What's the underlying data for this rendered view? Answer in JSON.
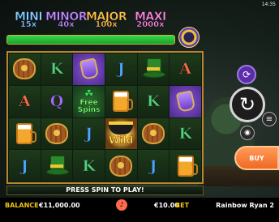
{
  "clock": "14:35",
  "jackpots": [
    {
      "name": "MINI",
      "multiplier": "15x"
    },
    {
      "name": "MINOR",
      "multiplier": "40x"
    },
    {
      "name": "MAJOR",
      "multiplier": "100x"
    },
    {
      "name": "MAXI",
      "multiplier": "2000x"
    }
  ],
  "meter": {
    "fill_percent": 100
  },
  "grid": [
    [
      "barrel",
      "K",
      "flask",
      "J",
      "hat",
      "A"
    ],
    [
      "A",
      "Q",
      "freespins",
      "beer",
      "K",
      "flask"
    ],
    [
      "beer",
      "barrel",
      "J",
      "wild",
      "barrel",
      "K"
    ],
    [
      "J",
      "hat",
      "K",
      "barrel",
      "J",
      "beer"
    ]
  ],
  "symbols": {
    "freespins_line1": "Free",
    "freespins_line2": "Spins",
    "wild_label": "Wild"
  },
  "message": "PRESS SPIN TO PLAY!",
  "buttons": {
    "buy": "BUY"
  },
  "status": {
    "balance_label": "BALANCE",
    "balance_value": "€11,000.00",
    "bet_value": "€10.00",
    "bet_label": "BET",
    "game_name": "Rainbow Ryan 2"
  },
  "icons": {
    "autoplay": "autoplay-icon",
    "spin": "spin-arrow-icon",
    "menu": "menu-icon",
    "stack": "coin-stack-icon",
    "sound": "sound-icon"
  }
}
